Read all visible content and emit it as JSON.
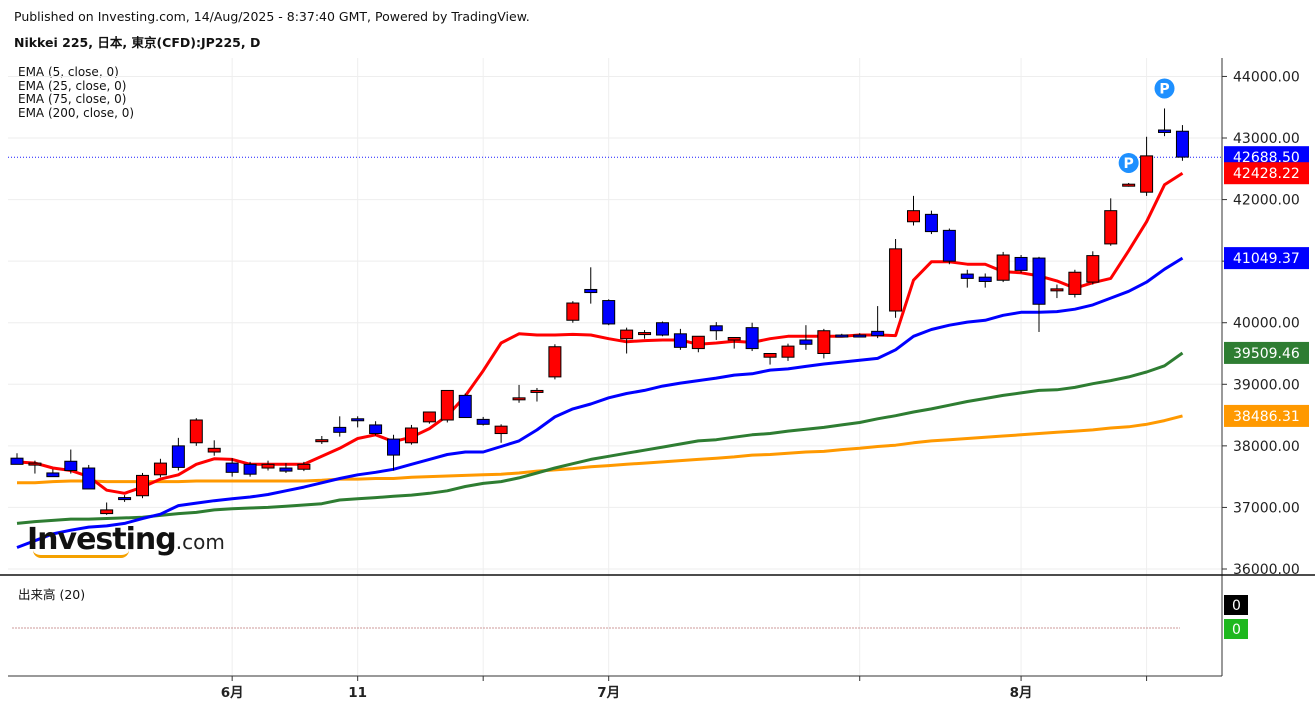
{
  "header": {
    "published": "Published on Investing.com, 14/Aug/2025 - 8:37:40 GMT, Powered by TradingView.",
    "symbol": "Nikkei 225, 日本, 東京(CFD):JP225, D"
  },
  "legend": [
    "EMA (5, close, 0)",
    "EMA (25, close, 0)",
    "EMA (75, close, 0)",
    "EMA (200, close, 0)"
  ],
  "volume_label": "出来高 (20)",
  "logo": {
    "brand": "Investing",
    "suffix": ".com"
  },
  "colors": {
    "up": "#ff0000",
    "down": "#0000ff",
    "ema5": "#ff0000",
    "ema25": "#0000ff",
    "ema75": "#2e7d32",
    "ema200": "#ff9900",
    "price_line": "#1a1aff"
  },
  "chart_data": {
    "type": "candlestick",
    "title": "Nikkei 225, 日本, 東京(CFD):JP225, D",
    "ylim": [
      36000,
      44300
    ],
    "y_ticks": [
      "44000.00",
      "43000.00",
      "42000.00",
      "41000.00",
      "40000.00",
      "39000.00",
      "38000.00",
      "37000.00",
      "36000.00"
    ],
    "x_ticks": [
      "6月",
      "11",
      "7月",
      "8月"
    ],
    "candles": [
      {
        "o": 37800,
        "h": 37880,
        "l": 37700,
        "c": 37700
      },
      {
        "o": 37700,
        "h": 37760,
        "l": 37550,
        "c": 37720
      },
      {
        "o": 37560,
        "h": 37620,
        "l": 37500,
        "c": 37500
      },
      {
        "o": 37750,
        "h": 37940,
        "l": 37550,
        "c": 37600
      },
      {
        "o": 37640,
        "h": 37690,
        "l": 37300,
        "c": 37300
      },
      {
        "o": 36900,
        "h": 37080,
        "l": 36880,
        "c": 36960
      },
      {
        "o": 37160,
        "h": 37200,
        "l": 37090,
        "c": 37140
      },
      {
        "o": 37190,
        "h": 37560,
        "l": 37150,
        "c": 37520
      },
      {
        "o": 37530,
        "h": 37790,
        "l": 37490,
        "c": 37720
      },
      {
        "o": 38000,
        "h": 38130,
        "l": 37600,
        "c": 37650
      },
      {
        "o": 38050,
        "h": 38450,
        "l": 38000,
        "c": 38420
      },
      {
        "o": 37900,
        "h": 38090,
        "l": 37840,
        "c": 37960
      },
      {
        "o": 37720,
        "h": 37800,
        "l": 37500,
        "c": 37570
      },
      {
        "o": 37700,
        "h": 37740,
        "l": 37500,
        "c": 37540
      },
      {
        "o": 37640,
        "h": 37760,
        "l": 37600,
        "c": 37700
      },
      {
        "o": 37640,
        "h": 37720,
        "l": 37560,
        "c": 37590
      },
      {
        "o": 37620,
        "h": 37740,
        "l": 37590,
        "c": 37700
      },
      {
        "o": 38080,
        "h": 38160,
        "l": 38030,
        "c": 38100
      },
      {
        "o": 38300,
        "h": 38480,
        "l": 38150,
        "c": 38220
      },
      {
        "o": 38440,
        "h": 38480,
        "l": 38300,
        "c": 38430
      },
      {
        "o": 38340,
        "h": 38400,
        "l": 38170,
        "c": 38200
      },
      {
        "o": 38110,
        "h": 38180,
        "l": 37600,
        "c": 37850
      },
      {
        "o": 38050,
        "h": 38340,
        "l": 38020,
        "c": 38290
      },
      {
        "o": 38390,
        "h": 38540,
        "l": 38360,
        "c": 38550
      },
      {
        "o": 38420,
        "h": 38850,
        "l": 38380,
        "c": 38900
      },
      {
        "o": 38820,
        "h": 38850,
        "l": 38460,
        "c": 38460
      },
      {
        "o": 38430,
        "h": 38470,
        "l": 38330,
        "c": 38350
      },
      {
        "o": 38200,
        "h": 38350,
        "l": 38050,
        "c": 38320
      },
      {
        "o": 38770,
        "h": 38990,
        "l": 38700,
        "c": 38780
      },
      {
        "o": 38900,
        "h": 38940,
        "l": 38720,
        "c": 38900
      },
      {
        "o": 39120,
        "h": 39650,
        "l": 39080,
        "c": 39610
      },
      {
        "o": 40040,
        "h": 40350,
        "l": 40000,
        "c": 40320
      },
      {
        "o": 40540,
        "h": 40900,
        "l": 40310,
        "c": 40490
      },
      {
        "o": 40360,
        "h": 40380,
        "l": 39960,
        "c": 39980
      },
      {
        "o": 39740,
        "h": 39920,
        "l": 39500,
        "c": 39880
      },
      {
        "o": 39820,
        "h": 39880,
        "l": 39740,
        "c": 39840
      },
      {
        "o": 40000,
        "h": 40020,
        "l": 39780,
        "c": 39800
      },
      {
        "o": 39820,
        "h": 39900,
        "l": 39560,
        "c": 39600
      },
      {
        "o": 39580,
        "h": 39780,
        "l": 39520,
        "c": 39780
      },
      {
        "o": 39950,
        "h": 40010,
        "l": 39720,
        "c": 39870
      },
      {
        "o": 39720,
        "h": 39740,
        "l": 39580,
        "c": 39760
      },
      {
        "o": 39920,
        "h": 40000,
        "l": 39540,
        "c": 39580
      },
      {
        "o": 39440,
        "h": 39480,
        "l": 39320,
        "c": 39500
      },
      {
        "o": 39440,
        "h": 39660,
        "l": 39380,
        "c": 39620
      },
      {
        "o": 39720,
        "h": 39960,
        "l": 39560,
        "c": 39650
      },
      {
        "o": 39500,
        "h": 39900,
        "l": 39420,
        "c": 39870
      },
      {
        "o": 39800,
        "h": 39820,
        "l": 39780,
        "c": 39790
      },
      {
        "o": 39800,
        "h": 39830,
        "l": 39780,
        "c": 39790
      },
      {
        "o": 39860,
        "h": 40270,
        "l": 39750,
        "c": 39790
      },
      {
        "o": 40190,
        "h": 41360,
        "l": 40080,
        "c": 41200
      },
      {
        "o": 41640,
        "h": 42060,
        "l": 41580,
        "c": 41820
      },
      {
        "o": 41760,
        "h": 41820,
        "l": 41440,
        "c": 41480
      },
      {
        "o": 41500,
        "h": 41530,
        "l": 40950,
        "c": 41000
      },
      {
        "o": 40790,
        "h": 40860,
        "l": 40570,
        "c": 40720
      },
      {
        "o": 40740,
        "h": 40800,
        "l": 40570,
        "c": 40670
      },
      {
        "o": 40690,
        "h": 41150,
        "l": 40660,
        "c": 41100
      },
      {
        "o": 41060,
        "h": 41100,
        "l": 40810,
        "c": 40850
      },
      {
        "o": 41050,
        "h": 41070,
        "l": 39850,
        "c": 40300
      },
      {
        "o": 40540,
        "h": 40620,
        "l": 40400,
        "c": 40550
      },
      {
        "o": 40460,
        "h": 40860,
        "l": 40410,
        "c": 40820
      },
      {
        "o": 40660,
        "h": 41160,
        "l": 40620,
        "c": 41090
      },
      {
        "o": 41280,
        "h": 42020,
        "l": 41250,
        "c": 41820
      },
      {
        "o": 42230,
        "h": 42270,
        "l": 42210,
        "c": 42250
      },
      {
        "o": 42120,
        "h": 43020,
        "l": 42060,
        "c": 42710
      },
      {
        "o": 43130,
        "h": 43480,
        "l": 43030,
        "c": 43090
      },
      {
        "o": 43110,
        "h": 43210,
        "l": 42630,
        "c": 42690
      }
    ],
    "ema5": [
      37740,
      37720,
      37640,
      37600,
      37500,
      37280,
      37230,
      37330,
      37460,
      37530,
      37700,
      37790,
      37780,
      37700,
      37700,
      37700,
      37700,
      37830,
      37960,
      38120,
      38180,
      38070,
      38140,
      38280,
      38490,
      38810,
      39220,
      39670,
      39820,
      39800,
      39800,
      39810,
      39800,
      39740,
      39690,
      39710,
      39720,
      39720,
      39650,
      39670,
      39700,
      39680,
      39740,
      39780,
      39780,
      39780,
      39780,
      39800,
      39800,
      39790,
      40690,
      40990,
      40990,
      40950,
      40950,
      40830,
      40810,
      40760,
      40680,
      40560,
      40650,
      40720,
      41170,
      41640,
      42240,
      42428
    ],
    "ema25": [
      36350,
      36460,
      36570,
      36630,
      36680,
      36700,
      36740,
      36820,
      36890,
      37030,
      37070,
      37110,
      37140,
      37170,
      37210,
      37270,
      37330,
      37400,
      37470,
      37530,
      37570,
      37620,
      37700,
      37780,
      37860,
      37900,
      37900,
      37990,
      38080,
      38260,
      38470,
      38600,
      38680,
      38780,
      38850,
      38900,
      38970,
      39020,
      39060,
      39100,
      39150,
      39170,
      39230,
      39250,
      39290,
      39330,
      39360,
      39390,
      39420,
      39560,
      39780,
      39890,
      39960,
      40010,
      40040,
      40120,
      40170,
      40170,
      40180,
      40220,
      40290,
      40400,
      40510,
      40660,
      40870,
      41049
    ],
    "ema75": [
      36740,
      36770,
      36790,
      36810,
      36810,
      36820,
      36830,
      36840,
      36870,
      36900,
      36920,
      36960,
      36980,
      36990,
      37000,
      37020,
      37040,
      37060,
      37120,
      37140,
      37160,
      37180,
      37200,
      37230,
      37270,
      37340,
      37390,
      37420,
      37480,
      37560,
      37640,
      37710,
      37780,
      37830,
      37880,
      37930,
      37980,
      38030,
      38080,
      38100,
      38140,
      38180,
      38200,
      38240,
      38270,
      38300,
      38340,
      38380,
      38440,
      38490,
      38550,
      38600,
      38660,
      38720,
      38770,
      38820,
      38860,
      38900,
      38910,
      38950,
      39010,
      39060,
      39120,
      39200,
      39300,
      39509
    ],
    "ema200": [
      37400,
      37400,
      37420,
      37430,
      37430,
      37420,
      37420,
      37420,
      37420,
      37420,
      37430,
      37430,
      37430,
      37430,
      37430,
      37430,
      37430,
      37440,
      37460,
      37460,
      37470,
      37470,
      37490,
      37500,
      37510,
      37520,
      37530,
      37540,
      37560,
      37590,
      37610,
      37630,
      37660,
      37680,
      37700,
      37720,
      37740,
      37760,
      37780,
      37800,
      37820,
      37850,
      37860,
      37880,
      37900,
      37910,
      37940,
      37960,
      37990,
      38010,
      38050,
      38080,
      38100,
      38120,
      38140,
      38160,
      38180,
      38200,
      38220,
      38240,
      38260,
      38290,
      38310,
      38350,
      38410,
      38486
    ],
    "last_price": 42688.5,
    "price_labels": [
      {
        "value": 42688.5,
        "text": "42688.50",
        "color": "#0000ff"
      },
      {
        "value": 42428.22,
        "text": "42428.22",
        "color": "#ff0000"
      },
      {
        "value": 41049.37,
        "text": "41049.37",
        "color": "#0000ff"
      },
      {
        "value": 39509.46,
        "text": "39509.46",
        "color": "#2e7d32"
      },
      {
        "value": 38486.31,
        "text": "38486.31",
        "color": "#ff9900"
      }
    ],
    "volume": {
      "ylim": [
        0,
        1
      ],
      "labels": [
        {
          "text": "0",
          "color": "#000000"
        },
        {
          "text": "0",
          "color": "#1fb81f"
        }
      ]
    },
    "markers": [
      {
        "candle": 64,
        "label": "P"
      },
      {
        "candle": 62,
        "label": "P"
      }
    ]
  }
}
